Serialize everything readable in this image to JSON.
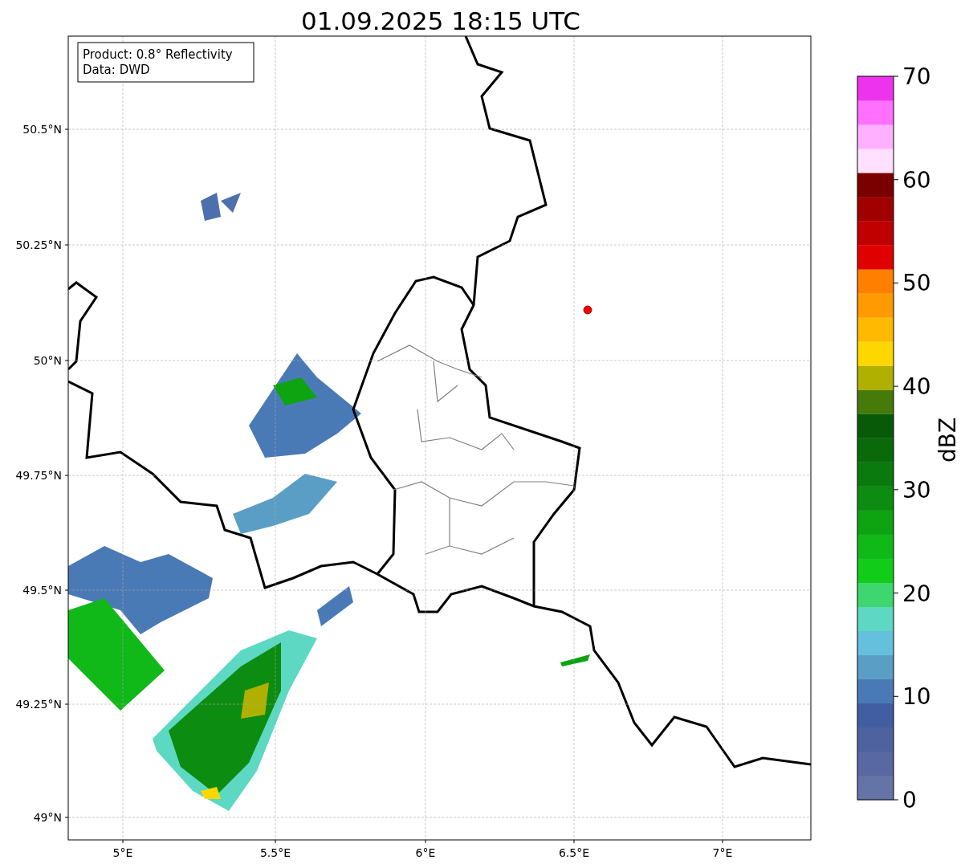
{
  "figure": {
    "title": "01.09.2025 18:15 UTC"
  },
  "info_box": {
    "lines": [
      "Product: 0.8° Reflectivity",
      "Data: DWD"
    ]
  },
  "map": {
    "x_ticks": [
      "5°E",
      "5.5°E",
      "6°E",
      "6.5°E",
      "7°E"
    ],
    "y_ticks": [
      "50.5°N",
      "50.25°N",
      "50°N",
      "49.75°N",
      "49.5°N",
      "49.25°N",
      "49°N"
    ],
    "markers": [
      {
        "kind": "radar-site",
        "color": "#ff0000"
      }
    ]
  },
  "colorbar": {
    "label": "dBZ",
    "ticks": [
      "70",
      "60",
      "50",
      "40",
      "30",
      "20",
      "10",
      "0"
    ],
    "segments": [
      {
        "color": "#6474a6"
      },
      {
        "color": "#5868a2"
      },
      {
        "color": "#4e62a0"
      },
      {
        "color": "#425ea2"
      },
      {
        "color": "#4a7ab5"
      },
      {
        "color": "#5a9ec6"
      },
      {
        "color": "#64c0dc"
      },
      {
        "color": "#5dd8c2"
      },
      {
        "color": "#3ed66e"
      },
      {
        "color": "#12cc1a"
      },
      {
        "color": "#10b818"
      },
      {
        "color": "#0ea311"
      },
      {
        "color": "#0c8c10"
      },
      {
        "color": "#0a7a0e"
      },
      {
        "color": "#0a6a0a"
      },
      {
        "color": "#085a08"
      },
      {
        "color": "#467b09"
      },
      {
        "color": "#b0b000"
      },
      {
        "color": "#ffd700"
      },
      {
        "color": "#ffb900"
      },
      {
        "color": "#ff9a00"
      },
      {
        "color": "#ff7f00"
      },
      {
        "color": "#e00000"
      },
      {
        "color": "#c00000"
      },
      {
        "color": "#a00000"
      },
      {
        "color": "#7a0000"
      },
      {
        "color": "#ffe0ff"
      },
      {
        "color": "#ffb0ff"
      },
      {
        "color": "#ff70ff"
      },
      {
        "color": "#ee33ee"
      }
    ]
  }
}
